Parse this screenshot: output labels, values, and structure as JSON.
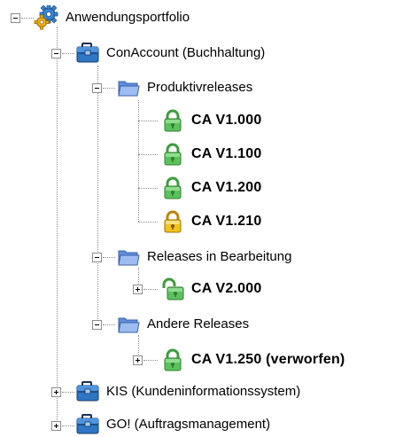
{
  "tree": {
    "root": {
      "label": "Anwendungsportfolio",
      "icon": "gear-icon",
      "expanded": true
    },
    "conaccount": {
      "label": "ConAccount (Buchhaltung)",
      "icon": "briefcase-icon",
      "expanded": true
    },
    "produktivreleases": {
      "label": "Produktivreleases",
      "icon": "folder-icon",
      "expanded": true
    },
    "ca_v1000": {
      "label": "CA V1.000",
      "icon": "lock-closed-green-icon"
    },
    "ca_v1100": {
      "label": "CA V1.100",
      "icon": "lock-closed-green-icon"
    },
    "ca_v1200": {
      "label": "CA V1.200",
      "icon": "lock-closed-green-icon"
    },
    "ca_v1210": {
      "label": "CA V1.210",
      "icon": "lock-closed-yellow-icon"
    },
    "releases_in_bearbeitung": {
      "label": "Releases in Bearbeitung",
      "icon": "folder-icon",
      "expanded": true
    },
    "ca_v2000": {
      "label": "CA V2.000",
      "icon": "lock-open-green-icon",
      "expanded": false
    },
    "andere_releases": {
      "label": "Andere Releases",
      "icon": "folder-icon",
      "expanded": true
    },
    "ca_v1250": {
      "label": "CA V1.250 (verworfen)",
      "icon": "lock-closed-green-icon",
      "expanded": false
    },
    "kis": {
      "label": "KIS (Kundeninformationssystem)",
      "icon": "briefcase-icon",
      "expanded": false
    },
    "go": {
      "label": "GO! (Auftragsmanagement)",
      "icon": "briefcase-icon",
      "expanded": false
    }
  },
  "colors": {
    "connector": "#8c8c8c",
    "lock_green": "#4db34d",
    "lock_yellow": "#e8b500",
    "folder_blue": "#7fa6ec",
    "briefcase_blue": "#2f76c4"
  }
}
